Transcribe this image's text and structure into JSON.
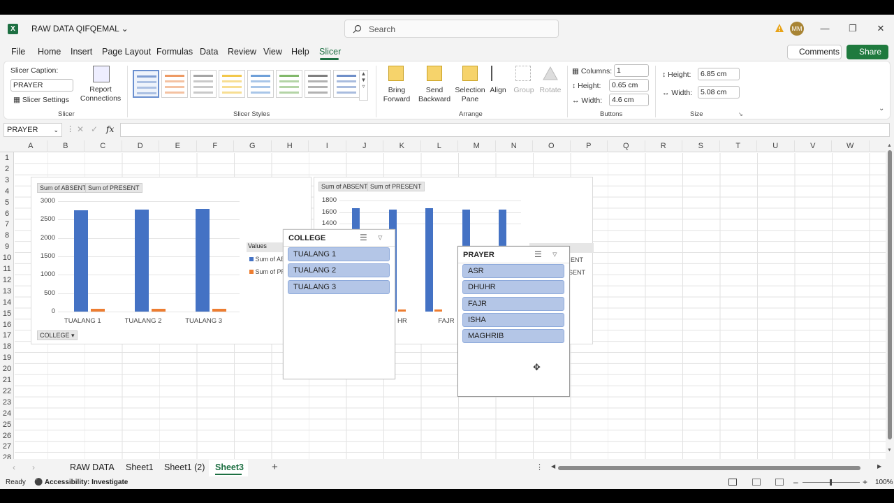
{
  "window": {
    "title": "RAW DATA QIFQEMAL",
    "search_placeholder": "Search",
    "avatar_initials": "MM"
  },
  "menu": [
    "File",
    "Home",
    "Insert",
    "Page Layout",
    "Formulas",
    "Data",
    "Review",
    "View",
    "Help",
    "Slicer"
  ],
  "actions": {
    "comments": "Comments",
    "share": "Share"
  },
  "ribbon": {
    "slicer_caption_label": "Slicer Caption:",
    "slicer_caption_value": "PRAYER",
    "slicer_settings": "Slicer Settings",
    "report_connections": "Report Connections",
    "group_slicer": "Slicer",
    "group_slicer_styles": "Slicer Styles",
    "bring_forward": "Bring Forward",
    "send_backward": "Send Backward",
    "selection_pane": "Selection Pane",
    "align": "Align",
    "group": "Group",
    "rotate": "Rotate",
    "group_arrange": "Arrange",
    "columns_label": "Columns:",
    "columns_value": "1",
    "btn_height_label": "Height:",
    "btn_height_value": "0.65 cm",
    "btn_width_label": "Width:",
    "btn_width_value": "4.6 cm",
    "group_buttons": "Buttons",
    "size_height_label": "Height:",
    "size_height_value": "6.85 cm",
    "size_width_label": "Width:",
    "size_width_value": "5.08 cm",
    "group_size": "Size",
    "style_colors": [
      "#7f9ed3",
      "#ed9a64",
      "#a5a5a5",
      "#f2c84b",
      "#6fa0d8",
      "#82b86b",
      "#7f7f7f",
      "#6f8fc8"
    ]
  },
  "formula_bar": {
    "name_box": "PRAYER",
    "fx": "fx"
  },
  "columns": [
    "A",
    "B",
    "C",
    "D",
    "E",
    "F",
    "G",
    "H",
    "I",
    "J",
    "K",
    "L",
    "M",
    "N",
    "O",
    "P",
    "Q",
    "R",
    "S",
    "T",
    "U",
    "V",
    "W"
  ],
  "rows": [
    "1",
    "2",
    "3",
    "4",
    "5",
    "6",
    "7",
    "8",
    "9",
    "10",
    "11",
    "12",
    "13",
    "14",
    "15",
    "16",
    "17",
    "18",
    "19",
    "20",
    "21",
    "22",
    "23",
    "24",
    "25",
    "26",
    "27",
    "28"
  ],
  "chart_data": [
    {
      "type": "bar",
      "categories": [
        "TUALANG 1",
        "TUALANG 2",
        "TUALANG 3"
      ],
      "series": [
        {
          "name": "Sum of ABSENT",
          "values": [
            2750,
            2770,
            2790
          ]
        },
        {
          "name": "Sum of PRESENT",
          "values": [
            70,
            70,
            85
          ]
        }
      ],
      "ylim": [
        0,
        3000
      ],
      "yticks": [
        "3000",
        "2500",
        "2000",
        "1500",
        "1000",
        "500",
        "0"
      ],
      "field_buttons": [
        "Sum of ABSENT",
        "Sum of PRESENT"
      ],
      "legend_title": "Values",
      "legend_entries": [
        "Sum of AB",
        "Sum of PR"
      ],
      "axis_button": "COLLEGE"
    },
    {
      "type": "bar",
      "categories": [
        "ASR",
        "DHUHR",
        "FAJR",
        "ISHA",
        "MAGHRIB"
      ],
      "visible_category_labels": [
        "HR",
        "FAJR"
      ],
      "series": [
        {
          "name": "Sum of ABSENT",
          "values": [
            1670,
            1650,
            1670,
            1650,
            1650
          ]
        },
        {
          "name": "Sum of PRESENT",
          "values": [
            20,
            20,
            15,
            20,
            20
          ]
        }
      ],
      "ylim": [
        0,
        1800
      ],
      "yticks": [
        "1800",
        "1600",
        "1400"
      ],
      "field_buttons": [
        "Sum of ABSENT",
        "Sum of PRESENT"
      ],
      "legend_entries": [
        "ENT",
        "SENT"
      ]
    }
  ],
  "slicers": {
    "college": {
      "title": "COLLEGE",
      "items": [
        "TUALANG 1",
        "TUALANG 2",
        "TUALANG 3"
      ]
    },
    "prayer": {
      "title": "PRAYER",
      "items": [
        "ASR",
        "DHUHR",
        "FAJR",
        "ISHA",
        "MAGHRIB"
      ]
    }
  },
  "sheets": [
    "RAW DATA",
    "Sheet1",
    "Sheet1 (2)",
    "Sheet3"
  ],
  "active_sheet": "Sheet3",
  "status": {
    "ready": "Ready",
    "accessibility": "Accessibility: Investigate",
    "zoom": "100%"
  }
}
